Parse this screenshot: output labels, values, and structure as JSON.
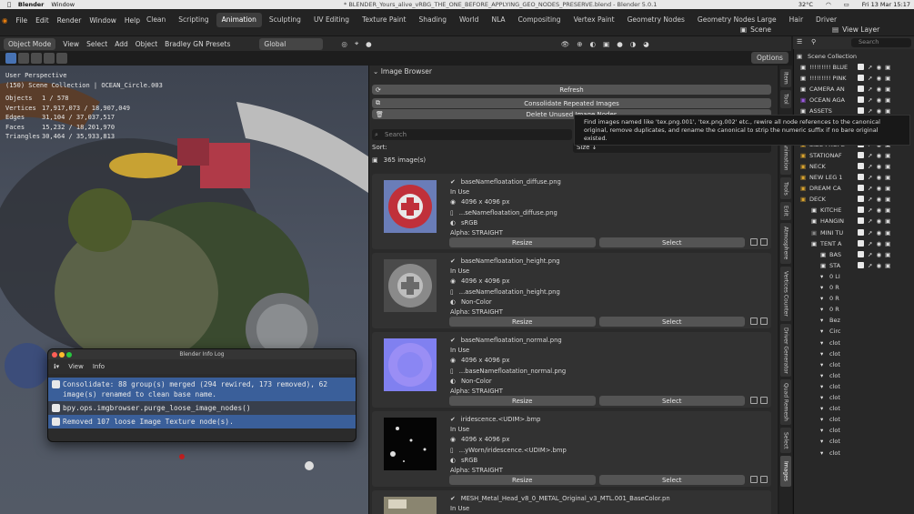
{
  "mac_menubar": {
    "app": "Blender",
    "menu": "Window",
    "title": "* BLENDER_Yours_alive_vRBG_THE_ONE_BEFORE_APPLYING_GEO_NODES_PRESERVE.blend - Blender 5.0.1",
    "temperature": "32°C",
    "datetime": "Fri 13 Mar 15:17"
  },
  "topbar": {
    "menus": [
      "File",
      "Edit",
      "Render",
      "Window",
      "Help"
    ],
    "workspaces": [
      "Clean",
      "Scripting",
      "Animation",
      "Sculpting",
      "UV Editing",
      "Texture Paint",
      "Shading",
      "World",
      "NLA",
      "Compositing",
      "Vertex Paint",
      "Geometry Nodes",
      "Geometry Nodes Large",
      "Hair",
      "Driver"
    ],
    "active_workspace": "Animation",
    "scene": "Scene",
    "view_layer": "View Layer"
  },
  "viewport_header": {
    "mode": "Object Mode",
    "menus": [
      "View",
      "Select",
      "Add",
      "Object",
      "Bradley GN Presets"
    ],
    "orientation": "Global",
    "options": "Options"
  },
  "viewport_stats": {
    "perspective": "User Perspective",
    "collection": "(150) Scene Collection | OCEAN_Circle.003",
    "objects_label": "Objects",
    "objects": "1 / 578",
    "vertices_label": "Vertices",
    "vertices": "17,917,073 / 18,907,049",
    "edges_label": "Edges",
    "edges": "31,104 / 37,037,517",
    "faces_label": "Faces",
    "faces": "15,232 / 18,201,970",
    "triangles_label": "Triangles",
    "triangles": "30,464 / 35,933,813"
  },
  "image_browser": {
    "title": "Image Browser",
    "refresh": "Refresh",
    "consolidate": "Consolidate Repeated Images",
    "delete_unused": "Delete Unused Image Nodes",
    "search_placeholder": "Search",
    "sort_label": "Sort:",
    "sort_value": "Size ↓",
    "count": "365 image(s)",
    "tooltip": "Find images named like 'tex.png.001', 'tex.png.002' etc., rewire all node references to the canonical original, remove duplicates, and rename the canonical to strip the numeric suffix if no bare original existed.",
    "resize_label": "Resize",
    "select_label": "Select",
    "images": [
      {
        "name": "baseNamefloatation_diffuse.png",
        "status": "In Use",
        "size": "4096 x 4096 px",
        "file": "...seNamefloatation_diffuse.png",
        "colorspace": "sRGB",
        "alpha": "Alpha: STRAIGHT"
      },
      {
        "name": "baseNamefloatation_height.png",
        "status": "In Use",
        "size": "4096 x 4096 px",
        "file": "...aseNamefloatation_height.png",
        "colorspace": "Non-Color",
        "alpha": "Alpha: STRAIGHT"
      },
      {
        "name": "baseNamefloatation_normal.png",
        "status": "In Use",
        "size": "4096 x 4096 px",
        "file": "...baseNamefloatation_normal.png",
        "colorspace": "Non-Color",
        "alpha": "Alpha: STRAIGHT"
      },
      {
        "name": "iridescence.<UDIM>.bmp",
        "status": "In Use",
        "size": "4096 x 4096 px",
        "file": "...yWorn/iridescence.<UDIM>.bmp",
        "colorspace": "sRGB",
        "alpha": "Alpha: STRAIGHT"
      },
      {
        "name": "MESH_Metal_Head_v8_0_METAL_Original_v3_MTL.001_BaseColor.pn",
        "status": "In Use"
      }
    ]
  },
  "side_tabs": [
    "Item",
    "Tool",
    "Animation",
    "Tools",
    "Edit",
    "Atmosphere",
    "Vertices Counter",
    "Driver Generator",
    "Quad Remesh",
    "Select",
    "Images"
  ],
  "outliner": {
    "title": "Scene Collection",
    "search_placeholder": "Search",
    "rows": [
      "!!!!!!!!! BLUE",
      "!!!!!!!!! PINK",
      "CAMERA AN",
      "OCEAN AGA",
      "ASSETS",
      "HEAD.001",
      "HEAD STAT",
      "SIDE PROPE",
      "STATIONAF",
      "NECK",
      "NEW LEG 1",
      "DREAM CA",
      "DECK",
      "KITCHE",
      "HANGIN",
      "MINI TU",
      "TENT A",
      "BAS",
      "STA",
      "0 LI",
      "0 R",
      "0 R",
      "0 R",
      "Bez",
      "Circ",
      "clot",
      "clot",
      "clot",
      "clot",
      "clot",
      "clot",
      "clot",
      "clot",
      "clot",
      "clot",
      "clot"
    ],
    "row_colors": [
      "#e6e6e6",
      "#e6e6e6",
      "#e6e6e6",
      "#9a58e0",
      "#e6e6e6",
      "#d9a32e",
      "#d9a32e",
      "#d9a32e",
      "#d9a32e",
      "#d9a32e",
      "#d9a32e",
      "#d9a32e",
      "#d9a32e",
      "#e6e6e6",
      "#e6e6e6",
      "#888888",
      "#e6e6e6",
      "#e6e6e6",
      "#e6e6e6",
      "#e6e6e6",
      "#e6e6e6",
      "#e6e6e6",
      "#e6e6e6",
      "#e6e6e6",
      "#e6e6e6",
      "#e6e6e6",
      "#e6e6e6",
      "#e6e6e6",
      "#e6e6e6",
      "#e6e6e6",
      "#e6e6e6",
      "#e6e6e6",
      "#e6e6e6",
      "#e6e6e6",
      "#e6e6e6",
      "#e6e6e6"
    ]
  },
  "info_log": {
    "title": "Blender Info Log",
    "menus": [
      "View",
      "Info"
    ],
    "lines": [
      "Consolidate: 88 group(s) merged (294 rewired, 173 removed), 62 image(s) renamed to clean base name.",
      "bpy.ops.imgbrowser.purge_loose_image_nodes()",
      "Removed 107 loose Image Texture node(s)."
    ]
  },
  "colors": {
    "accent": "#4772b3",
    "log_info_bg": "#3a5f9a",
    "panel_bg": "#2a2a2a"
  }
}
